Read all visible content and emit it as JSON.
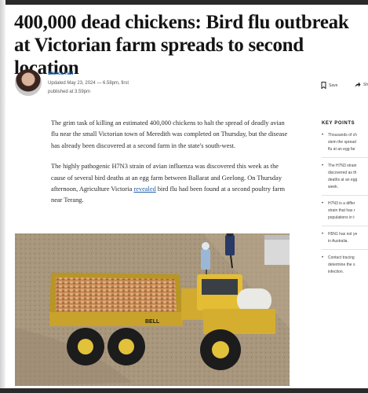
{
  "article": {
    "headline": "400,000 dead chickens: Bird flu outbreak at Victorian farm spreads to second location",
    "author": "Bianca Hall",
    "updated_line1": "Updated May 23, 2024 — 6.58pm, first",
    "updated_line2": "published at 3.59pm",
    "paragraph1": "The grim task of killing an estimated 400,000 chickens to halt the spread of deadly avian flu near the small Victorian town of Meredith was completed on Thursday, but the disease has already been discovered at a second farm in the state's south-west.",
    "paragraph2_a": "The highly pathogenic H7N3 strain of avian influenza was discovered this week as the cause of several bird deaths at an egg farm between Ballarat and Geelong. On Thursday afternoon, Agriculture Victoria ",
    "paragraph2_link": "revealed",
    "paragraph2_b": " bird flu had been found at a second poultry farm near Terang."
  },
  "toolbar": {
    "save_label": "Save",
    "share_label": "Sh"
  },
  "key_points": {
    "title": "KEY POINTS",
    "items": [
      "Thousands of ch\nstem the spread\nflu at an egg far",
      "The H7N3 strain\ndiscovered as th\ndeaths at an egg\nweek.",
      "H7N3 is a differ\nstrain that has r\npopulations in t",
      "H5N1 has not ye\nin Australia.",
      "Contact tracing\ndetermine the s\ninfection."
    ]
  },
  "photo": {
    "truck_brand": "BELL"
  },
  "icons": {
    "save": "bookmark-icon",
    "share": "share-arrow-icon"
  }
}
